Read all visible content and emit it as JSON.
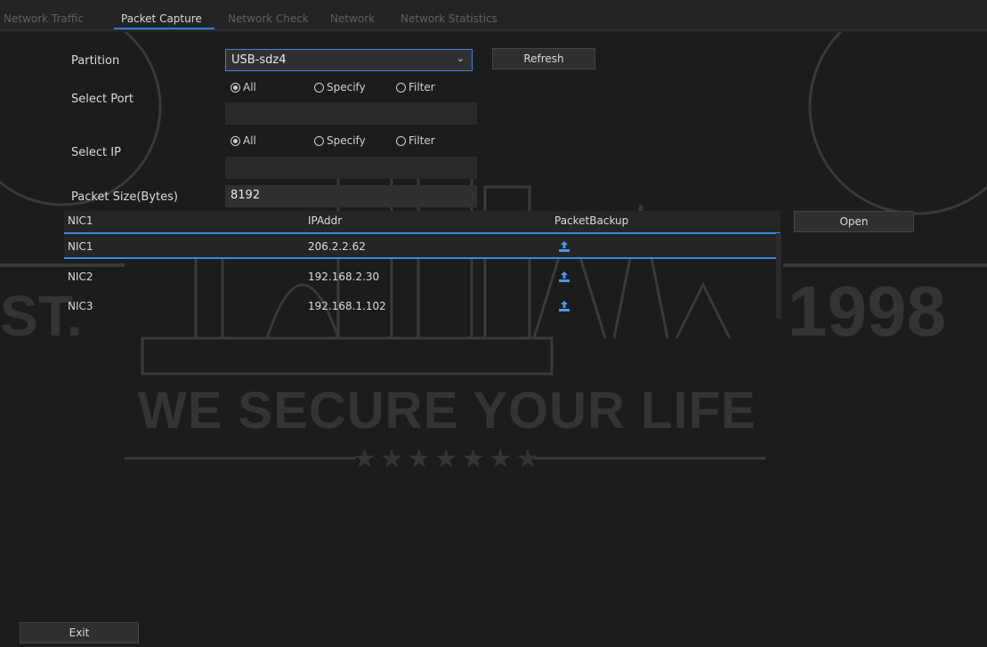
{
  "tabs": [
    {
      "label": "Network Traffic"
    },
    {
      "label": "Packet Capture"
    },
    {
      "label": "Network Check"
    },
    {
      "label": "Network"
    },
    {
      "label": "Network Statistics"
    }
  ],
  "form": {
    "partition_label": "Partition",
    "partition_value": "USB-sdz4",
    "refresh_label": "Refresh",
    "select_port_label": "Select Port",
    "port_options": [
      "All",
      "Specify",
      "Filter"
    ],
    "select_ip_label": "Select IP",
    "ip_options": [
      "All",
      "Specify",
      "Filter"
    ],
    "packet_size_label": "Packet Size(Bytes)",
    "packet_size_value": "8192"
  },
  "table": {
    "columns": [
      "NIC1",
      "IPAddr",
      "PacketBackup"
    ],
    "rows": [
      {
        "nic": "NIC1",
        "ip": "206.2.2.62"
      },
      {
        "nic": "NIC2",
        "ip": "192.168.2.30"
      },
      {
        "nic": "NIC3",
        "ip": "192.168.1.102"
      }
    ]
  },
  "open_label": "Open",
  "exit_label": "Exit",
  "watermark": {
    "est": "ST.",
    "year": "1998",
    "slogan": "WE SECURE YOUR LIFE",
    "stars": "★ ★ ★ ★ ★ ★ ★"
  },
  "colors": {
    "accent": "#3b86df",
    "background": "#1c1c1c"
  }
}
